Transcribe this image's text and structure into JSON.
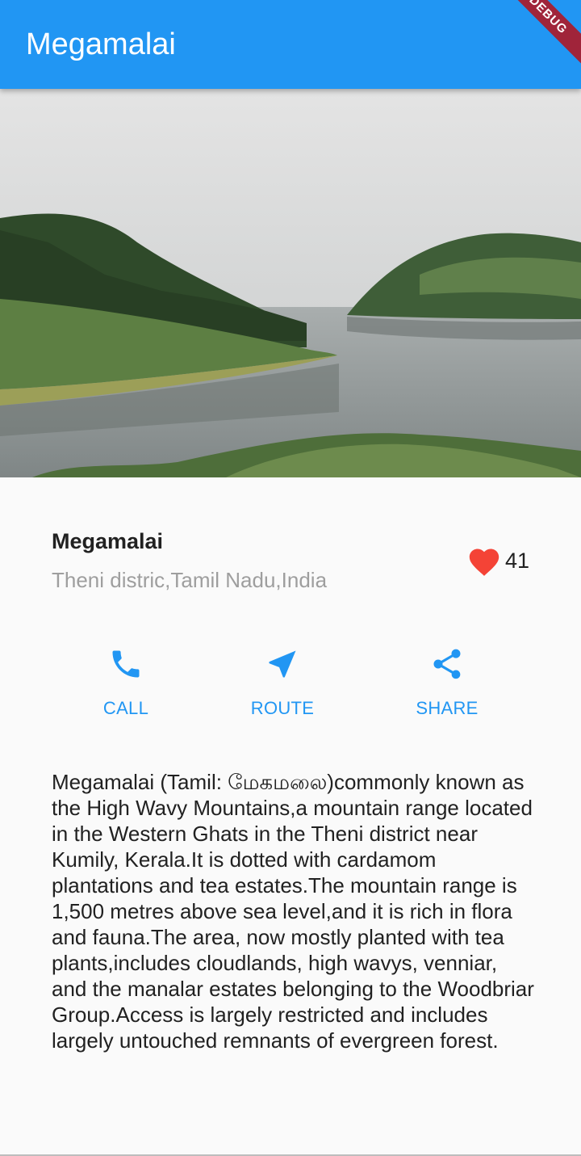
{
  "app_bar": {
    "title": "Megamalai",
    "debug_banner": "DEBUG"
  },
  "place": {
    "name": "Megamalai",
    "location": "Theni distric,Tamil Nadu,India",
    "favorite_count": "41"
  },
  "actions": [
    {
      "label": "CALL",
      "icon": "phone-icon"
    },
    {
      "label": "ROUTE",
      "icon": "navigation-icon"
    },
    {
      "label": "SHARE",
      "icon": "share-icon"
    }
  ],
  "description": "Megamalai (Tamil: மேகமலை)commonly known as the High Wavy Mountains,a mountain range located in the Western Ghats in the Theni district near Kumily, Kerala.It is dotted with cardamom plantations and tea estates.The mountain range is 1,500 metres above sea level,and it is rich in flora and fauna.The area, now mostly planted with tea plants,includes cloudlands, high wavys, venniar, and the manalar estates belonging to the Woodbriar Group.Access is largely restricted and includes largely untouched remnants of evergreen forest.",
  "colors": {
    "primary": "#2196f3",
    "heart": "#f44336",
    "subtitle": "#9e9e9e"
  }
}
